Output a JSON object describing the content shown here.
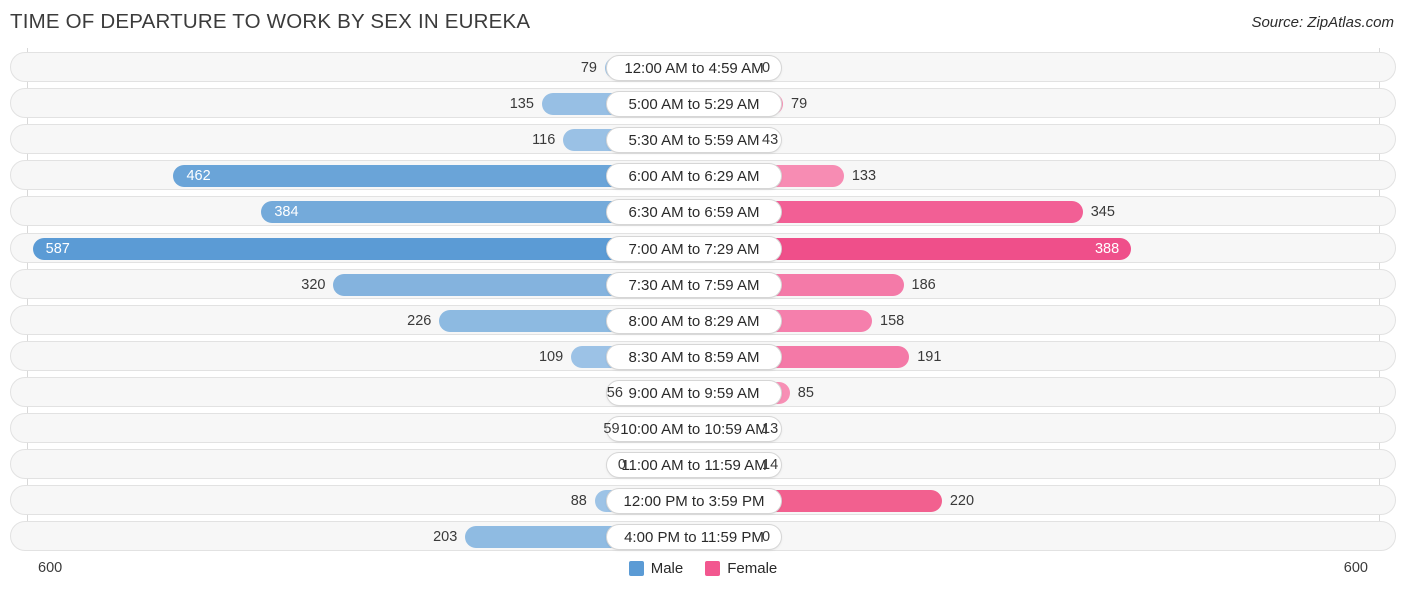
{
  "header": {
    "title": "TIME OF DEPARTURE TO WORK BY SEX IN EUREKA",
    "source": "Source: ZipAtlas.com"
  },
  "legend": {
    "items": [
      {
        "label": "Male",
        "color": "#5b9bd5"
      },
      {
        "label": "Female",
        "color": "#f2578f"
      }
    ]
  },
  "axis": {
    "left_end": "600",
    "right_end": "600",
    "max": 600
  },
  "chart_data": {
    "type": "bar",
    "title": "TIME OF DEPARTURE TO WORK BY SEX IN EUREKA",
    "xlabel": "",
    "ylabel": "",
    "orientation": "horizontal-diverging",
    "grid": false,
    "legend_position": "bottom-center",
    "xlim": [
      -600,
      600
    ],
    "axis_max": 600,
    "categories": [
      "12:00 AM to 4:59 AM",
      "5:00 AM to 5:29 AM",
      "5:30 AM to 5:59 AM",
      "6:00 AM to 6:29 AM",
      "6:30 AM to 6:59 AM",
      "7:00 AM to 7:29 AM",
      "7:30 AM to 7:59 AM",
      "8:00 AM to 8:29 AM",
      "8:30 AM to 8:59 AM",
      "9:00 AM to 9:59 AM",
      "10:00 AM to 10:59 AM",
      "11:00 AM to 11:59 AM",
      "12:00 PM to 3:59 PM",
      "4:00 PM to 11:59 PM"
    ],
    "series": [
      {
        "name": "Male",
        "color": "#5b9bd5",
        "values": [
          79,
          135,
          116,
          462,
          384,
          587,
          320,
          226,
          109,
          56,
          59,
          0,
          88,
          203
        ]
      },
      {
        "name": "Female",
        "color": "#f2578f",
        "values": [
          0,
          79,
          43,
          133,
          345,
          388,
          186,
          158,
          191,
          85,
          13,
          14,
          220,
          0
        ]
      }
    ]
  },
  "rows": [
    {
      "label": "12:00 AM to 4:59 AM",
      "male": 79,
      "female": 0,
      "male_text": "79",
      "female_text": "0",
      "male_color": "#9dc3e6",
      "female_color": "#f9a8c5"
    },
    {
      "label": "5:00 AM to 5:29 AM",
      "male": 135,
      "female": 79,
      "male_text": "135",
      "female_text": "79",
      "male_color": "#97bfe4",
      "female_color": "#f792b7"
    },
    {
      "label": "5:30 AM to 5:59 AM",
      "male": 116,
      "female": 43,
      "male_text": "116",
      "female_text": "43",
      "male_color": "#9ac1e5",
      "female_color": "#f9a2c1"
    },
    {
      "label": "6:00 AM to 6:29 AM",
      "male": 462,
      "female": 133,
      "male_text": "462",
      "female_text": "133",
      "male_color": "#6aa4d8",
      "female_color": "#f78cb3"
    },
    {
      "label": "6:30 AM to 6:59 AM",
      "male": 384,
      "female": 345,
      "male_text": "384",
      "female_text": "345",
      "male_color": "#74aada",
      "female_color": "#f25f95"
    },
    {
      "label": "7:00 AM to 7:29 AM",
      "male": 587,
      "female": 388,
      "male_text": "587",
      "female_text": "388",
      "male_color": "#5b9bd5",
      "female_color": "#ef4f8a"
    },
    {
      "label": "7:30 AM to 7:59 AM",
      "male": 320,
      "female": 186,
      "male_text": "320",
      "female_text": "186",
      "male_color": "#84b3de",
      "female_color": "#f47aa8"
    },
    {
      "label": "8:00 AM to 8:29 AM",
      "male": 226,
      "female": 158,
      "male_text": "226",
      "female_text": "158",
      "male_color": "#8dbae1",
      "female_color": "#f57fac"
    },
    {
      "label": "8:30 AM to 8:59 AM",
      "male": 109,
      "female": 191,
      "male_text": "109",
      "female_text": "191",
      "male_color": "#9cc2e6",
      "female_color": "#f479a7"
    },
    {
      "label": "9:00 AM to 9:59 AM",
      "male": 56,
      "female": 85,
      "male_text": "56",
      "female_text": "85",
      "male_color": "#9dc3e6",
      "female_color": "#f78fb5"
    },
    {
      "label": "10:00 AM to 10:59 AM",
      "male": 59,
      "female": 13,
      "male_text": "59",
      "female_text": "13",
      "male_color": "#9dc3e6",
      "female_color": "#f9a8c5"
    },
    {
      "label": "11:00 AM to 11:59 AM",
      "male": 0,
      "female": 14,
      "male_text": "0",
      "female_text": "14",
      "male_color": "#a8c9e9",
      "female_color": "#f9a2c1"
    },
    {
      "label": "12:00 PM to 3:59 PM",
      "male": 88,
      "female": 220,
      "male_text": "88",
      "female_text": "220",
      "male_color": "#9dc3e6",
      "female_color": "#f2608f"
    },
    {
      "label": "4:00 PM to 11:59 PM",
      "male": 203,
      "female": 0,
      "male_text": "203",
      "female_text": "0",
      "male_color": "#8fbbe2",
      "female_color": "#f9a8c5"
    }
  ]
}
